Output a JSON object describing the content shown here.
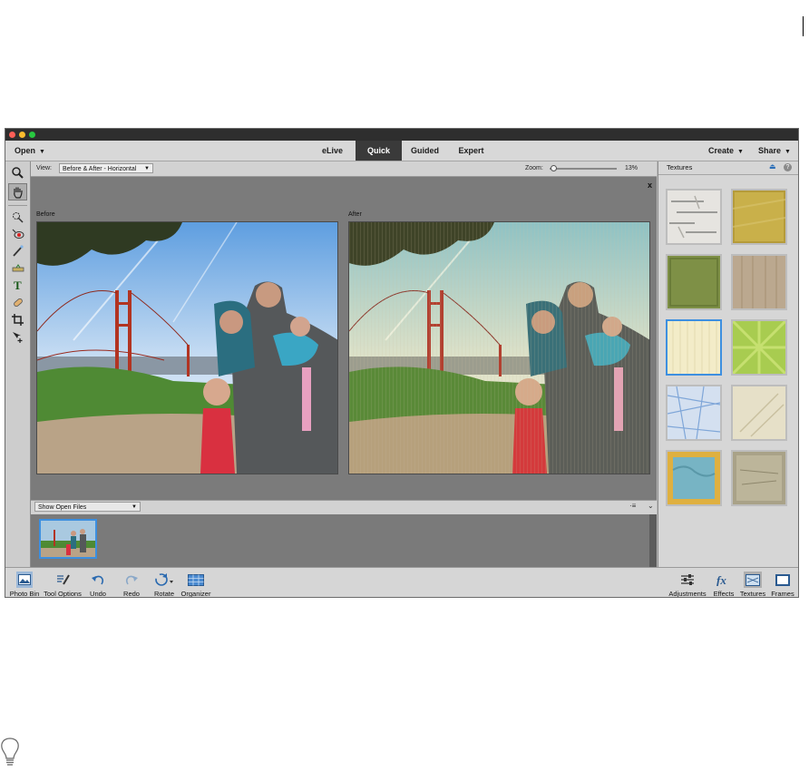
{
  "menubar": {
    "open_label": "Open",
    "tabs": [
      {
        "label": "eLive"
      },
      {
        "label": "Quick"
      },
      {
        "label": "Guided"
      },
      {
        "label": "Expert"
      }
    ],
    "create_label": "Create",
    "share_label": "Share"
  },
  "viewbar": {
    "view_label": "View:",
    "view_value": "Before & After - Horizontal",
    "zoom_label": "Zoom:",
    "zoom_value": "13%",
    "zoom_fraction": 0.02
  },
  "canvas": {
    "before_label": "Before",
    "after_label": "After",
    "close_label": "x"
  },
  "photo_bin": {
    "show_label": "Show Open Files"
  },
  "panel": {
    "title": "Textures",
    "selected_index": 4
  },
  "bottombar": {
    "left": [
      {
        "label": "Photo Bin",
        "icon": "photo-bin-icon"
      },
      {
        "label": "Tool Options",
        "icon": "tool-options-icon"
      },
      {
        "label": "Undo",
        "icon": "undo-icon"
      },
      {
        "label": "Redo",
        "icon": "redo-icon"
      },
      {
        "label": "Rotate",
        "icon": "rotate-icon"
      },
      {
        "label": "Organizer",
        "icon": "organizer-icon"
      }
    ],
    "right": [
      {
        "label": "Adjustments",
        "icon": "adjustments-icon"
      },
      {
        "label": "Effects",
        "icon": "fx-icon"
      },
      {
        "label": "Textures",
        "icon": "textures-icon"
      },
      {
        "label": "Frames",
        "icon": "frames-icon"
      }
    ]
  },
  "colors": {
    "accent": "#3d8fe0",
    "active_tab": "#3a3a3a"
  }
}
